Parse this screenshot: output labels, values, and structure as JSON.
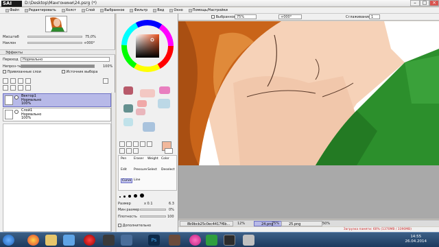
{
  "window": {
    "logo_prefix": "",
    "logo_text": "SAI",
    "title": "D:\\Desktop\\Мангонини\\24.psrg (*)"
  },
  "menu": [
    {
      "label": "Файл"
    },
    {
      "label": "Редактировать"
    },
    {
      "label": "Холст"
    },
    {
      "label": "Слой"
    },
    {
      "label": "Выбранное"
    },
    {
      "label": "Фильтр"
    },
    {
      "label": "Вид"
    },
    {
      "label": "Окно"
    },
    {
      "label": "Помощь/Настройки"
    }
  ],
  "navigator": {
    "zoom_label": "Масштаб",
    "zoom_value": "75,0%",
    "angle_label": "Наклон",
    "angle_value": "+000°"
  },
  "effects": {
    "header": "Эффекты",
    "mode_label": "Переход",
    "mode_value": "Нормально",
    "opacity_label": "Непроз-ть",
    "opacity_value": "100%",
    "clip_label": "Привязанные слои",
    "source_label": "Источник выбора"
  },
  "layers": [
    {
      "name": "Вектор1",
      "mode": "Нормально",
      "opacity": "100%",
      "active": true
    },
    {
      "name": "Слой1",
      "mode": "Нормально",
      "opacity": "100%",
      "active": false
    }
  ],
  "canvas_toolbar": {
    "selection_label": "Выбранное",
    "zoom_value": "75%",
    "angle_value": "+000°",
    "stabilizer_label": "Сглаживание",
    "stabilizer_value": "1"
  },
  "swatches": {
    "primary_color": "#f2b89b",
    "secondary_color": "#ffffff",
    "palette": [
      "#b85a6a",
      "#f3c8c3",
      "#e87fbf",
      "#64908f",
      "#f0a8a8",
      "#bcd8e6",
      "#e9b6bc",
      "#c0e2ea",
      "#a9c3dd"
    ]
  },
  "brush_tools": {
    "row1": [
      "Pen",
      "Eraser",
      "Weight",
      "Color"
    ],
    "row2": [
      "Edit",
      "Pressure",
      "Select",
      "Deselect"
    ],
    "row3": [
      "Curve",
      "Line"
    ]
  },
  "brush_settings": {
    "size_label": "Размер",
    "size_mult": "x 0.1",
    "size_value": "6.3",
    "min_size_label": "Мин размер",
    "min_size_value": "0%",
    "density_label": "Плотность",
    "density_value": "100",
    "extra_label": "Дополнительно"
  },
  "doc_tabs": [
    {
      "name": "8b9bcb25c0ec4417f6b...",
      "zoom": "12%"
    },
    {
      "name": "24.png",
      "zoom": "75%"
    },
    {
      "name": "25.png",
      "zoom": "50%"
    }
  ],
  "status": {
    "memory": "Загрузка памяти: 60% (1370MB / 3390MB)"
  },
  "taskbar": {
    "time": "14:55",
    "date": "26.04.2014"
  }
}
